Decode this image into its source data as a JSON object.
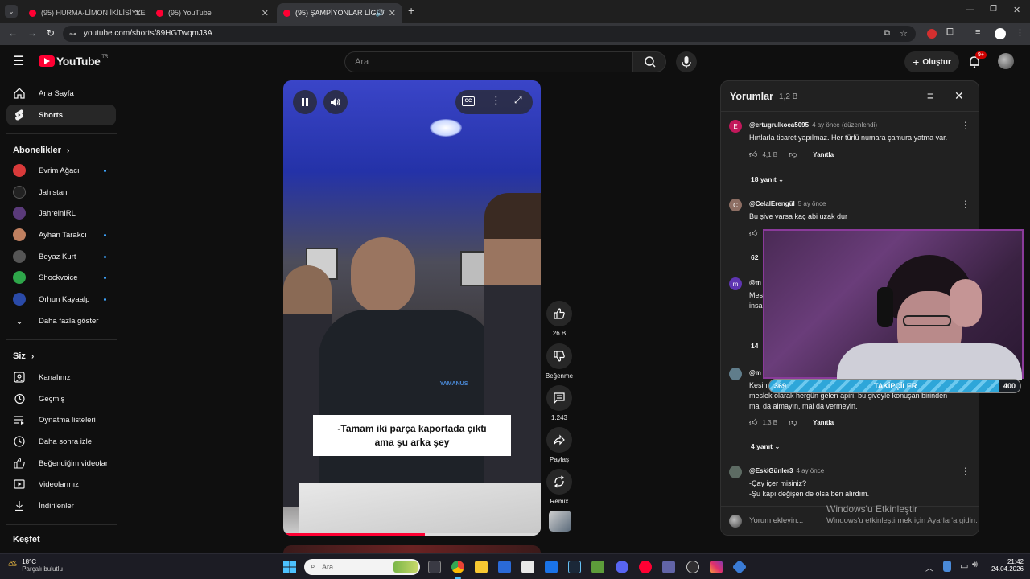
{
  "browser": {
    "tabs": [
      {
        "title": "(95) HURMA-LİMON İKİLİSİYLE"
      },
      {
        "title": "(95) YouTube"
      },
      {
        "title": "(95) ŞAMPİYONLAR LİGİ //"
      }
    ],
    "url": "youtube.com/shorts/89HGTwqmJ3A"
  },
  "header": {
    "logo": "YouTube",
    "logo_region": "TR",
    "search_placeholder": "Ara",
    "create_label": "Oluştur",
    "notifications_badge": "9+"
  },
  "sidebar": {
    "top": [
      {
        "label": "Ana Sayfa",
        "icon": "home-icon"
      },
      {
        "label": "Shorts",
        "icon": "shorts-icon"
      }
    ],
    "subscriptions_title": "Abonelikler",
    "subscriptions": [
      {
        "label": "Evrim Ağacı",
        "color": "#d93a3a",
        "new": true
      },
      {
        "label": "Jahistan",
        "color": "#222222",
        "new": false
      },
      {
        "label": "JahreinIRL",
        "color": "#5a3a7a",
        "new": false
      },
      {
        "label": "Ayhan Tarakcı",
        "color": "#c08060",
        "new": true
      },
      {
        "label": "Beyaz Kurt",
        "color": "#555555",
        "new": true
      },
      {
        "label": "Shockvoice",
        "color": "#2ea64a",
        "new": true
      },
      {
        "label": "Orhun Kayaalp",
        "color": "#2a4aa8",
        "new": true
      }
    ],
    "show_more": "Daha fazla göster",
    "you_title": "Siz",
    "you": [
      {
        "label": "Kanalınız",
        "icon": "channel-icon"
      },
      {
        "label": "Geçmiş",
        "icon": "history-icon"
      },
      {
        "label": "Oynatma listeleri",
        "icon": "playlists-icon"
      },
      {
        "label": "Daha sonra izle",
        "icon": "watch-later-icon"
      },
      {
        "label": "Beğendiğim videolar",
        "icon": "liked-icon"
      },
      {
        "label": "Videolarınız",
        "icon": "your-videos-icon"
      },
      {
        "label": "İndirilenler",
        "icon": "downloads-icon"
      }
    ],
    "explore_title": "Keşfet"
  },
  "video": {
    "subtitle_line1": "-Tamam iki parça kaportada çıktı",
    "subtitle_line2": "ama şu arka şey",
    "shirt_text": "YAMANUS"
  },
  "actions": {
    "likes": "26 B",
    "dislike": "Beğenme",
    "comments": "1.243",
    "share": "Paylaş",
    "remix": "Remix"
  },
  "comments_panel": {
    "title": "Yorumlar",
    "count": "1,2 B",
    "items": [
      {
        "avatar": "E",
        "avatar_color": "#c2185b",
        "user": "@ertugrulkoca5095",
        "time": "4 ay önce (düzenlendi)",
        "text": "Hırtlarla ticaret yapılmaz. Her türlü numara çamura yatma var.",
        "likes": "4,1 B",
        "reply": "Yanıtla",
        "replies": "18 yanıt"
      },
      {
        "avatar": "C",
        "avatar_color": "#8d6e63",
        "user": "@CelalErengül",
        "time": "5 ay önce",
        "text": "Bu şive varsa kaç abi uzak dur",
        "replies_partial": "62"
      },
      {
        "avatar": "m",
        "avatar_color": "#5e35b1",
        "user_partial": "@m",
        "text_partial_1": "Mes",
        "text_partial_2": "insa",
        "replies_partial": "14"
      },
      {
        "user_partial": "@m",
        "text_partial": "Kesinl",
        "text_line2": "meslek olarak hergün gelen apiri, bu şiveyle konuşan birinden",
        "text_line3": "mal da almayın, mal da vermeyin.",
        "likes": "1,3 B",
        "reply": "Yanıtla",
        "replies": "4 yanıt"
      },
      {
        "user": "@EskiGünler3",
        "time": "4 ay önce",
        "text_line1": "-Çay içer misiniz?",
        "text_line2": "-Şu kapı değişen de olsa ben alırdım."
      }
    ],
    "input_placeholder": "Yorum ekleyin..."
  },
  "overlay": {
    "follow_current": 369,
    "follow_label": "TAKİPÇİLER",
    "follow_goal": 400,
    "progress_fraction": 0.9225
  },
  "watermark": {
    "title": "Windows'u Etkinleştir",
    "subtitle": "Windows'u etkinleştirmek için Ayarlar'a gidin."
  },
  "taskbar": {
    "temperature": "18°C",
    "weather": "Parçalı bulutlu",
    "search_placeholder": "Ara",
    "time": "21:42",
    "date": "24.04.2026"
  }
}
